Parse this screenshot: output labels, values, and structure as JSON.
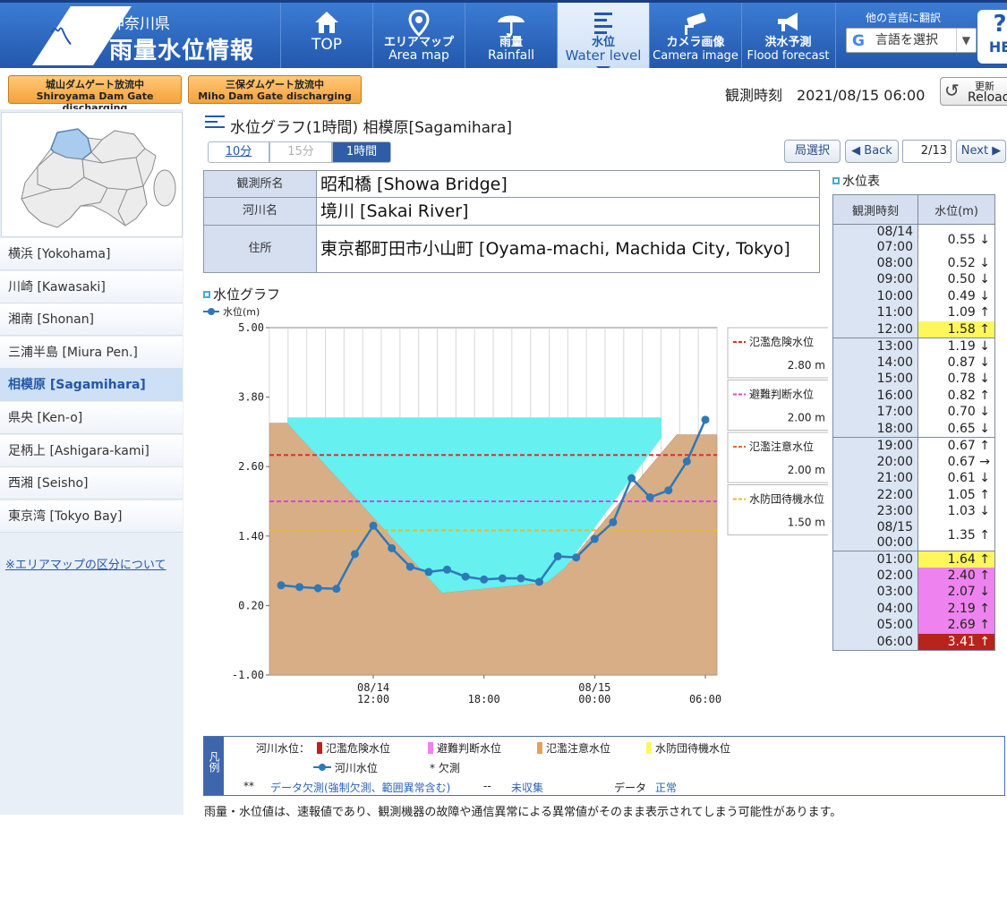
{
  "header": {
    "pref_name": "神奈川県",
    "site_title": "雨量水位情報",
    "nav": [
      {
        "jp": "",
        "en": "TOP",
        "icon": "home-icon"
      },
      {
        "jp": "エリアマップ",
        "en": "Area map",
        "icon": "map-pin-icon"
      },
      {
        "jp": "雨量",
        "en": "Rainfall",
        "icon": "umbrella-icon"
      },
      {
        "jp": "水位",
        "en": "Water level",
        "icon": "water-level-icon"
      },
      {
        "jp": "カメラ画像",
        "en": "Camera image",
        "icon": "camera-icon"
      },
      {
        "jp": "洪水予測",
        "en": "Flood forecast",
        "icon": "megaphone-icon"
      }
    ],
    "translate_label": "他の言語に翻訳",
    "translate_select": "言語を選択",
    "help": "HE"
  },
  "subbar": {
    "dam1_jp": "城山ダムゲート放流中",
    "dam1_en": "Shiroyama Dam Gate discharging",
    "dam2_jp": "三保ダムゲート放流中",
    "dam2_en": "Miho Dam Gate discharging",
    "obs_time": "観測時刻　2021/08/15 06:00",
    "reload_jp": "更新",
    "reload_en": "Reload"
  },
  "sidebar": {
    "areas": [
      "横浜 [Yokohama]",
      "川崎 [Kawasaki]",
      "湘南 [Shonan]",
      "三浦半島 [Miura Pen.]",
      "相模原 [Sagamihara]",
      "県央 [Ken-o]",
      "足柄上 [Ashigara-kami]",
      "西湘 [Seisho]",
      "東京湾 [Tokyo Bay]"
    ],
    "selected_index": 4,
    "note": "※エリアマップの区分について"
  },
  "main": {
    "title": "水位グラフ(1時間) 相模原[Sagamihara]",
    "intervals": [
      "10分",
      "15分",
      "1時間"
    ],
    "station_select": "局選択",
    "back": "◀ Back",
    "page": "2/13",
    "next": "Next ▶",
    "info": [
      {
        "label": "観測所名",
        "value": "昭和橋 [Showa Bridge]"
      },
      {
        "label": "河川名",
        "value": "境川 [Sakai River]"
      },
      {
        "label": "住所",
        "value": "東京都町田市小山町 [Oyama-machi, Machida City, Tokyo]"
      }
    ],
    "wl_table_title": "水位表",
    "wl_table_headers": [
      "観測時刻",
      "水位(m)"
    ],
    "wl_rows": [
      {
        "time": "08/14 07:00",
        "val": "0.55 ↓",
        "bg": "#ffffff"
      },
      {
        "time": "08:00",
        "val": "0.52 ↓",
        "bg": "#ffffff"
      },
      {
        "time": "09:00",
        "val": "0.50 ↓",
        "bg": "#ffffff"
      },
      {
        "time": "10:00",
        "val": "0.49 ↓",
        "bg": "#ffffff"
      },
      {
        "time": "11:00",
        "val": "1.09 ↑",
        "bg": "#ffffff"
      },
      {
        "time": "12:00",
        "val": "1.58 ↑",
        "bg": "#fdf75c"
      },
      {
        "time": "13:00",
        "val": "1.19 ↓",
        "bg": "#ffffff"
      },
      {
        "time": "14:00",
        "val": "0.87 ↓",
        "bg": "#ffffff"
      },
      {
        "time": "15:00",
        "val": "0.78 ↓",
        "bg": "#ffffff"
      },
      {
        "time": "16:00",
        "val": "0.82 ↑",
        "bg": "#ffffff"
      },
      {
        "time": "17:00",
        "val": "0.70 ↓",
        "bg": "#ffffff"
      },
      {
        "time": "18:00",
        "val": "0.65 ↓",
        "bg": "#ffffff"
      },
      {
        "time": "19:00",
        "val": "0.67 ↑",
        "bg": "#ffffff"
      },
      {
        "time": "20:00",
        "val": "0.67 →",
        "bg": "#ffffff"
      },
      {
        "time": "21:00",
        "val": "0.61 ↓",
        "bg": "#ffffff"
      },
      {
        "time": "22:00",
        "val": "1.05 ↑",
        "bg": "#ffffff"
      },
      {
        "time": "23:00",
        "val": "1.03 ↓",
        "bg": "#ffffff"
      },
      {
        "time": "08/15 00:00",
        "val": "1.35 ↑",
        "bg": "#ffffff"
      },
      {
        "time": "01:00",
        "val": "1.64 ↑",
        "bg": "#fdf75c"
      },
      {
        "time": "02:00",
        "val": "2.40 ↑",
        "bg": "#ee82ee"
      },
      {
        "time": "03:00",
        "val": "2.07 ↓",
        "bg": "#ee82ee"
      },
      {
        "time": "04:00",
        "val": "2.19 ↑",
        "bg": "#ee82ee"
      },
      {
        "time": "05:00",
        "val": "2.69 ↑",
        "bg": "#ee82ee"
      },
      {
        "time": "06:00",
        "val": "3.41 ↑",
        "bg": "#b8231b",
        "fg": "#ffffff"
      }
    ],
    "graph_title": "水位グラフ",
    "thresholds": [
      {
        "name": "氾濫危険水位",
        "value": "2.80 m",
        "color": "#d9302c"
      },
      {
        "name": "避難判断水位",
        "value": "2.00 m",
        "color": "#e040e0"
      },
      {
        "name": "氾濫注意水位",
        "value": "2.00 m",
        "color": "#e26a2c"
      },
      {
        "name": "水防団待機水位",
        "value": "1.50 m",
        "color": "#e8b830"
      }
    ],
    "legend": {
      "side": "凡例",
      "river_label": "河川水位：",
      "items": [
        {
          "name": "氾濫危険水位",
          "color": "#b8231b"
        },
        {
          "name": "避難判断水位",
          "color": "#ee82ee"
        },
        {
          "name": "氾濫注意水位",
          "color": "#e6a05a"
        },
        {
          "name": "水防団待機水位",
          "color": "#fdf75c"
        }
      ],
      "series": "河川水位",
      "missing_mark": "* 欠測",
      "dbl": "**",
      "dbl_text": "データ欠測(強制欠測、範囲異常含む)",
      "dash": "--",
      "dash_text": "未収集",
      "data_label": "データ",
      "data_value": "正常"
    },
    "footnote": "雨量・水位値は、速報値であり、観測機器の故障や通信異常による異常値がそのまま表示されてしまう可能性があります。"
  },
  "chart_data": {
    "type": "line",
    "legend_label": "水位(m)",
    "series_name": "河川水位",
    "ylim": [
      -1.0,
      5.0
    ],
    "yticks": [
      "5.00",
      "3.80",
      "2.60",
      "1.40",
      "0.20",
      "-1.00"
    ],
    "xticks": [
      {
        "label": "08/14\n12:00",
        "index": 5
      },
      {
        "label": "18:00",
        "index": 11
      },
      {
        "label": "08/15\n00:00",
        "index": 17
      },
      {
        "label": "06:00",
        "index": 23
      }
    ],
    "x": [
      "08/14 07:00",
      "08:00",
      "09:00",
      "10:00",
      "11:00",
      "12:00",
      "13:00",
      "14:00",
      "15:00",
      "16:00",
      "17:00",
      "18:00",
      "19:00",
      "20:00",
      "21:00",
      "22:00",
      "23:00",
      "08/15 00:00",
      "01:00",
      "02:00",
      "03:00",
      "04:00",
      "05:00",
      "06:00"
    ],
    "values": [
      0.55,
      0.52,
      0.5,
      0.49,
      1.09,
      1.58,
      1.19,
      0.87,
      0.78,
      0.82,
      0.7,
      0.65,
      0.67,
      0.67,
      0.61,
      1.05,
      1.03,
      1.35,
      1.64,
      2.4,
      2.07,
      2.19,
      2.69,
      3.41
    ],
    "thresholds": {
      "danger": 2.8,
      "evacuation": 2.0,
      "caution": 1.5
    },
    "line_color": "#2e78b7",
    "water_color": "#66f0f0",
    "bank_color": "#d8ae86"
  }
}
